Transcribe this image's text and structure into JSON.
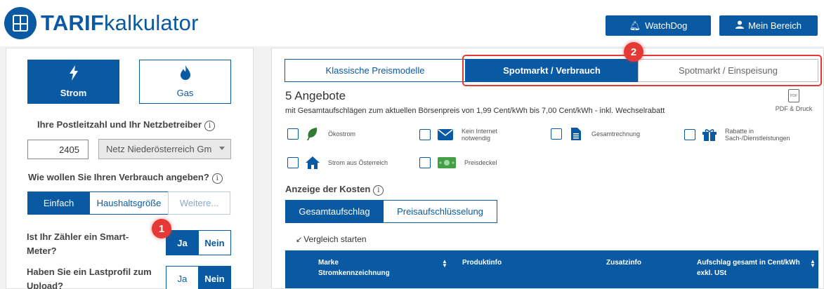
{
  "header": {
    "logo_bold": "TARIF",
    "logo_rest": "kalkulator",
    "watchdog_label": "WatchDog",
    "meinbereich_label": "Mein Bereich"
  },
  "left": {
    "energy": {
      "strom": "Strom",
      "gas": "Gas"
    },
    "plz_label": "Ihre Postleitzahl und Ihr Netzbetreiber",
    "plz_value": "2405",
    "netz_value": "Netz Niederösterreich Gm",
    "verbrauch_label": "Wie wollen Sie Ihren Verbrauch angeben?",
    "verbrauch_options": [
      "Einfach",
      "Haushaltsgröße",
      "Weitere..."
    ],
    "smart_question": "Ist Ihr Zähler ein Smart-Meter?",
    "lastprofil_question": "Haben Sie ein Lastprofil zum Upload?",
    "yes": "Ja",
    "no": "Nein"
  },
  "right": {
    "tabs": [
      "Klassische Preismodelle",
      "Spotmarkt / Verbrauch",
      "Spotmarkt / Einspeisung"
    ],
    "angebote": "5 Angebote",
    "subline": "mit Gesamtaufschlägen zum aktuellen Börsenpreis von 1,99 Cent/kWh bis 7,00 Cent/kWh - inkl. Wechselrabatt",
    "pdf_label": "PDF & Druck",
    "filters": [
      {
        "label": "Ökostrom",
        "icon": "leaf-icon"
      },
      {
        "label": "Kein Internet notwendig",
        "icon": "envelope-icon"
      },
      {
        "label": "Gesamtrechnung",
        "icon": "document-icon"
      },
      {
        "label": "Rabatte in Sach-/Dienstleistungen",
        "icon": "gift-icon"
      },
      {
        "label": "Strom aus Österreich",
        "icon": "house-icon"
      },
      {
        "label": "Preisdeckel",
        "icon": "money-icon"
      }
    ],
    "kosten_label": "Anzeige der Kosten",
    "kosten_tabs": [
      "Gesamtaufschlag",
      "Preisaufschlüsselung"
    ],
    "vergleich_label": "Vergleich starten",
    "table_headers": {
      "marke_1": "Marke",
      "marke_2": "Stromkennzeichnung",
      "produktinfo": "Produktinfo",
      "zusatzinfo": "Zusatzinfo",
      "aufschlag_1": "Aufschlag gesamt in Cent/kWh",
      "aufschlag_2": "exkl. USt"
    }
  },
  "annotations": {
    "marker1": "1",
    "marker2": "2"
  },
  "colors": {
    "brand": "#0a5aa3",
    "annotation": "#e53935",
    "leaf": "#2e7d32",
    "money": "#43a047"
  }
}
